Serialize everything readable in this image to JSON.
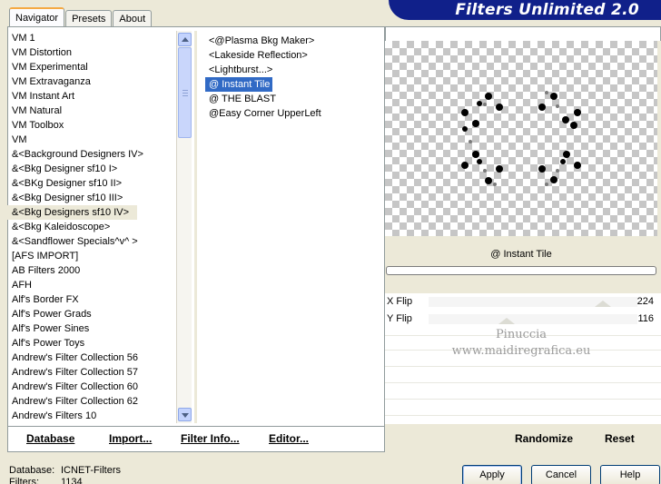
{
  "tabs": [
    "Navigator",
    "Presets",
    "About"
  ],
  "app_title": "Filters Unlimited 2.0",
  "categories": [
    "VM 1",
    "VM Distortion",
    "VM Experimental",
    "VM Extravaganza",
    "VM Instant Art",
    "VM Natural",
    "VM Toolbox",
    "VM",
    "&<Background Designers IV>",
    "&<Bkg Designer sf10 I>",
    "&<BKg Designer sf10 II>",
    "&<Bkg Designer sf10 III>",
    "&<Bkg Designers sf10 IV>",
    "&<Bkg Kaleidoscope>",
    "&<Sandflower Specials^v^ >",
    "[AFS IMPORT]",
    "AB Filters 2000",
    "AFH",
    "Alf's Border FX",
    "Alf's Power Grads",
    "Alf's Power Sines",
    "Alf's Power Toys",
    "Andrew's Filter Collection 56",
    "Andrew's Filter Collection 57",
    "Andrew's Filter Collection 60",
    "Andrew's Filter Collection 62",
    "Andrew's Filters 10"
  ],
  "highlighted_category": "&<Bkg Designers sf10 IV>",
  "filters": [
    "<@Plasma Bkg Maker>",
    "<Lakeside Reflection>",
    "<Lightburst...>",
    "@ Instant Tile",
    "@ THE BLAST",
    "@Easy Corner UpperLeft"
  ],
  "selected_filter": "@ Instant Tile",
  "preview_filter_name": "@ Instant Tile",
  "sliders": [
    {
      "label": "X Flip",
      "value": "224"
    },
    {
      "label": "Y Flip",
      "value": "116"
    }
  ],
  "watermark": [
    "Pinuccia",
    "www.maidiregrafica.eu"
  ],
  "bottom_buttons": {
    "database": "Database",
    "import": "Import...",
    "filter_info": "Filter Info...",
    "editor": "Editor..."
  },
  "randomize": "Randomize",
  "reset": "Reset",
  "status": {
    "database_label": "Database:",
    "database_value": "ICNET-Filters",
    "filters_label": "Filters:",
    "filters_value": "1134"
  },
  "dialog_buttons": {
    "apply": "Apply",
    "cancel": "Cancel",
    "help": "Help"
  }
}
